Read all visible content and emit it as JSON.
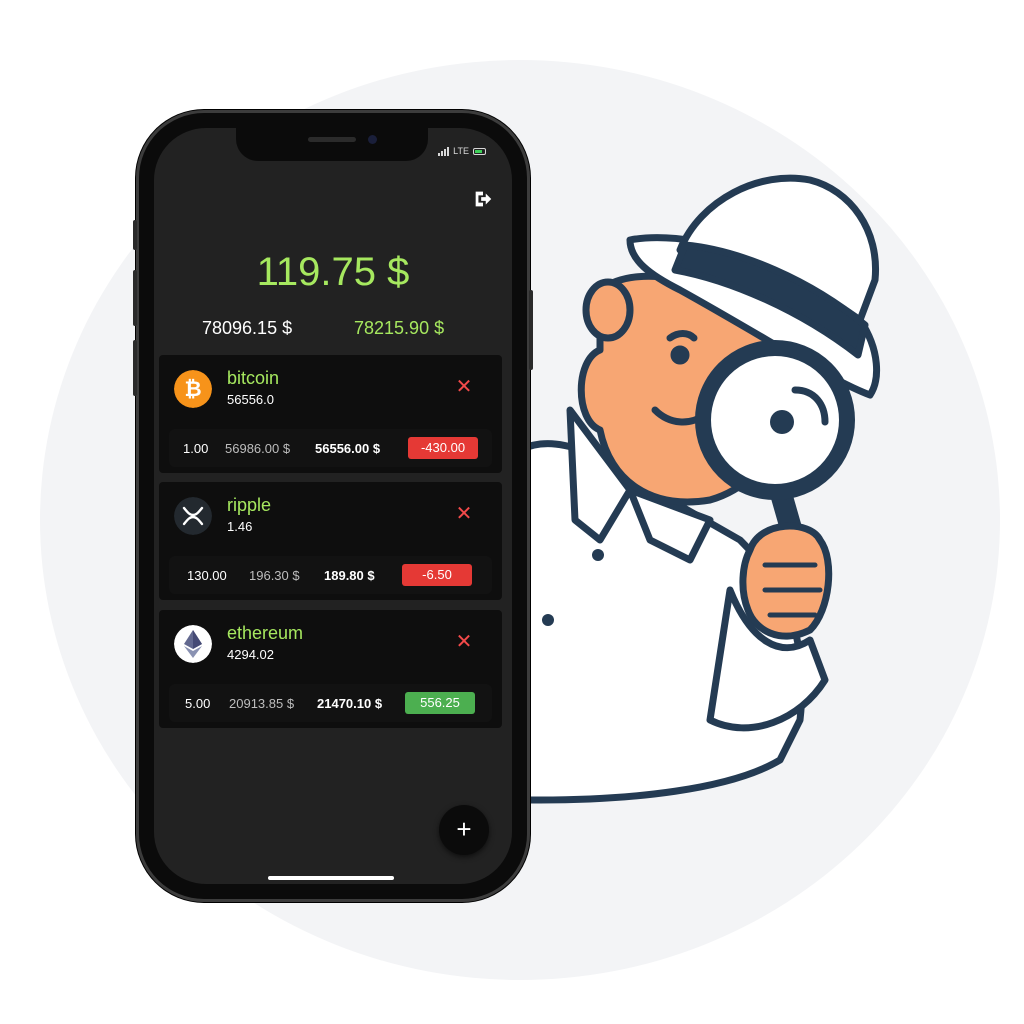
{
  "status": {
    "network": "LTE"
  },
  "portfolio": {
    "total_diff": "119.75 $",
    "invested": "78096.15 $",
    "current": "78215.90 $"
  },
  "coins": [
    {
      "name": "bitcoin",
      "price": "56556.0",
      "quantity": "1.00",
      "buy_value": "56986.00 $",
      "current_value": "56556.00 $",
      "difference": "-430.00",
      "icon": "bitcoin-icon",
      "difference_color": "#e53935"
    },
    {
      "name": "ripple",
      "price": "1.46",
      "quantity": "130.00",
      "buy_value": "196.30 $",
      "current_value": "189.80 $",
      "difference": "-6.50",
      "icon": "ripple-icon",
      "difference_color": "#e53935"
    },
    {
      "name": "ethereum",
      "price": "4294.02",
      "quantity": "5.00",
      "buy_value": "20913.85 $",
      "current_value": "21470.10 $",
      "difference": "556.25",
      "icon": "ethereum-icon",
      "difference_color": "#4caf50"
    }
  ],
  "actions": {
    "add": "+",
    "remove": "✕"
  },
  "colors": {
    "accent": "#a6e85f",
    "screen_bg": "#222222",
    "card_bg": "#0e0e0e",
    "negative": "#e53935",
    "positive": "#4caf50",
    "remove": "#f24a4a"
  }
}
